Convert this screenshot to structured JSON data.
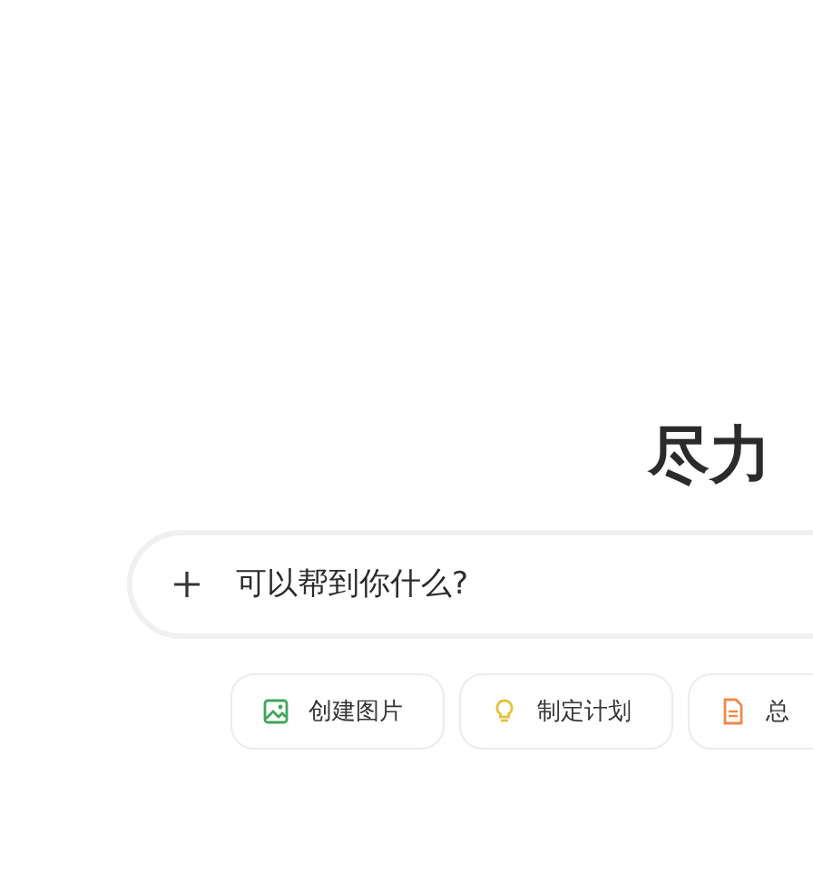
{
  "heading": "尽力",
  "composer": {
    "placeholder": "可以帮到你什么?"
  },
  "suggestions": [
    {
      "kind": "image",
      "label": "创建图片"
    },
    {
      "kind": "idea",
      "label": "制定计划"
    },
    {
      "kind": "document",
      "label": "总"
    }
  ]
}
